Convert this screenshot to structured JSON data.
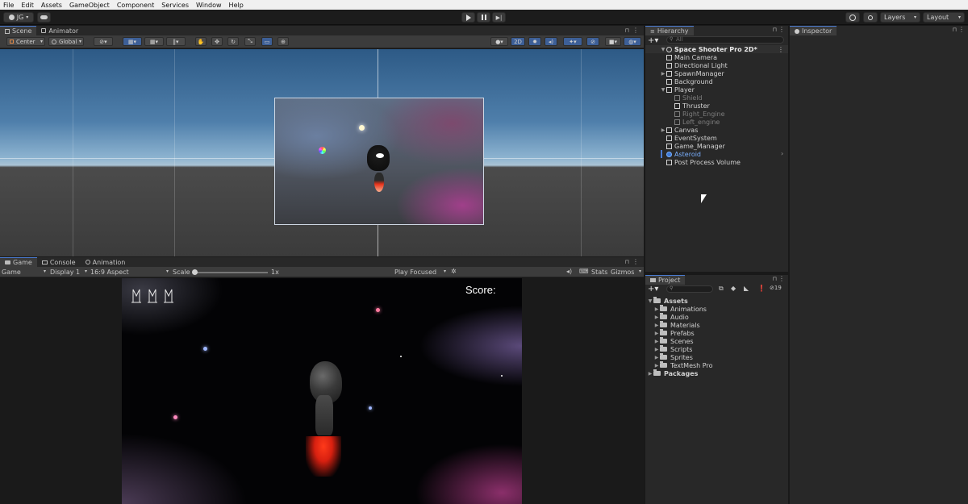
{
  "menu": [
    "File",
    "Edit",
    "Assets",
    "GameObject",
    "Component",
    "Services",
    "Window",
    "Help"
  ],
  "toolbar": {
    "account": "JG",
    "layers_label": "Layers",
    "layout_label": "Layout"
  },
  "scene_tabs": [
    "Scene",
    "Animator"
  ],
  "scene_toolbar": {
    "pivot": "Center",
    "space": "Global",
    "mode_2d": "2D"
  },
  "game_tabs": [
    "Game",
    "Console",
    "Animation"
  ],
  "game_toolbar": {
    "view": "Game",
    "display": "Display 1",
    "aspect": "16:9 Aspect",
    "scale_label": "Scale",
    "scale_value": "1x",
    "play_mode": "Play Focused",
    "stats": "Stats",
    "gizmos": "Gizmos"
  },
  "game_view": {
    "score_label": "Score:"
  },
  "hierarchy": {
    "tab": "Hierarchy",
    "search_placeholder": "All",
    "scene_name": "Space Shooter Pro 2D*",
    "items": [
      {
        "label": "Main Camera",
        "depth": 1,
        "expand": "",
        "state": "normal"
      },
      {
        "label": "Directional Light",
        "depth": 1,
        "expand": "",
        "state": "normal"
      },
      {
        "label": "SpawnManager",
        "depth": 1,
        "expand": "▶",
        "state": "normal"
      },
      {
        "label": "Background",
        "depth": 1,
        "expand": "",
        "state": "normal"
      },
      {
        "label": "Player",
        "depth": 1,
        "expand": "▼",
        "state": "normal"
      },
      {
        "label": "Shield",
        "depth": 2,
        "expand": "",
        "state": "dim"
      },
      {
        "label": "Thruster",
        "depth": 2,
        "expand": "",
        "state": "normal"
      },
      {
        "label": "Right_Engine",
        "depth": 2,
        "expand": "",
        "state": "dim"
      },
      {
        "label": "Left_engine",
        "depth": 2,
        "expand": "",
        "state": "dim"
      },
      {
        "label": "Canvas",
        "depth": 1,
        "expand": "▶",
        "state": "normal"
      },
      {
        "label": "EventSystem",
        "depth": 1,
        "expand": "",
        "state": "normal"
      },
      {
        "label": "Game_Manager",
        "depth": 1,
        "expand": "",
        "state": "normal"
      },
      {
        "label": "Asteroid",
        "depth": 1,
        "expand": "",
        "state": "sel"
      },
      {
        "label": "Post Process Volume",
        "depth": 1,
        "expand": "",
        "state": "normal"
      }
    ]
  },
  "inspector": {
    "tab": "Inspector"
  },
  "project": {
    "tab": "Project",
    "hidden_count": "19",
    "root": "Assets",
    "folders": [
      "Animations",
      "Audio",
      "Materials",
      "Prefabs",
      "Scenes",
      "Scripts",
      "Sprites",
      "TextMesh Pro"
    ],
    "packages": "Packages"
  },
  "colors": {
    "accent": "#4a7bd0",
    "selected_text": "#7ab0ff",
    "panel_bg": "#282828",
    "toolbar_bg": "#3c3c3c",
    "thruster": "#e8321a"
  }
}
